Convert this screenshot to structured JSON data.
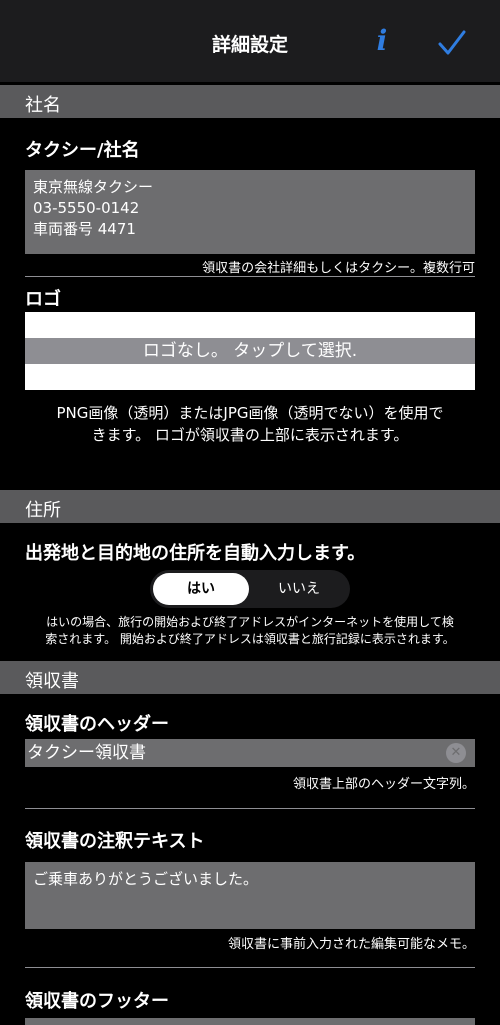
{
  "navbar": {
    "title": "詳細設定",
    "info_glyph": "i",
    "accent": "#2f7de1"
  },
  "company_section": {
    "header": "社名",
    "taxi_label": "タクシー/社名",
    "taxi_lines": [
      "東京無線タクシー",
      "03-5550-0142",
      "車両番号 4471"
    ],
    "taxi_helper": "領収書の会社詳細もしくはタクシー。複数行可",
    "logo_label": "ロゴ",
    "logo_placeholder": "ロゴなし。 タップして選択.",
    "logo_desc_line1": "PNG画像（透明）またはJPG画像（透明でない）を使用で",
    "logo_desc_line2": "きます。 ロゴが領収書の上部に表示されます。"
  },
  "address_section": {
    "header": "住所",
    "autofill_label": "出発地と目的地の住所を自動入力します。",
    "toggle_options": [
      "はい",
      "いいえ"
    ],
    "toggle_selected": "はい",
    "desc_line1": "はいの場合、旅行の開始および終了アドレスがインターネットを使用して検",
    "desc_line2": "索されます。 開始および終了アドレスは領収書と旅行記録に表示されます。"
  },
  "receipt_section": {
    "header": "領収書",
    "header_label": "領収書のヘッダー",
    "header_value": "タクシー領収書",
    "header_helper": "領収書上部のヘッダー文字列。",
    "note_label": "領収書の注釈テキスト",
    "note_value": "ご乗車ありがとうございました。",
    "note_helper": "領収書に事前入力された編集可能なメモ。",
    "footer_label": "領収書のフッター"
  }
}
